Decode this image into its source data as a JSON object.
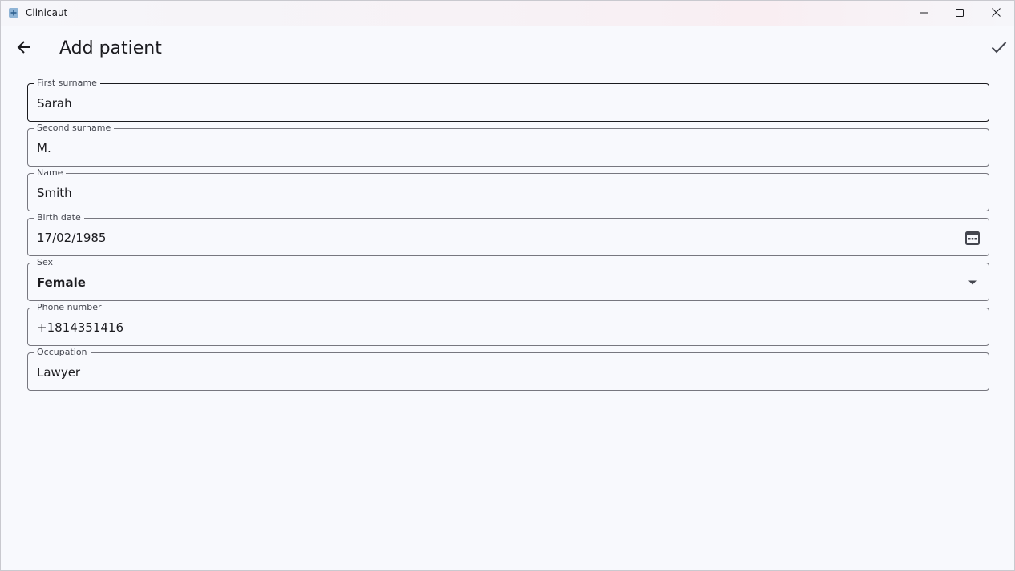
{
  "window": {
    "app_title": "Clinicaut",
    "app_icon": "app-plus-icon",
    "controls": {
      "minimize": "minimize-icon",
      "maximize": "maximize-icon",
      "close": "close-icon"
    }
  },
  "appbar": {
    "back_icon": "arrow-back-icon",
    "title": "Add patient",
    "save_icon": "check-icon"
  },
  "form": {
    "fields": [
      {
        "label": "First surname",
        "value": "Sarah"
      },
      {
        "label": "Second surname",
        "value": "M."
      },
      {
        "label": "Name",
        "value": "Smith"
      },
      {
        "label": "Birth date",
        "value": "17/02/1985",
        "trailing_icon": "calendar-icon"
      },
      {
        "label": "Sex",
        "value": "Female",
        "trailing_icon": "dropdown-arrow-icon"
      },
      {
        "label": "Phone number",
        "value": "+1814351416"
      },
      {
        "label": "Occupation",
        "value": "Lawyer"
      }
    ]
  },
  "colors": {
    "background": "#f8f9fd",
    "outline": "#77777f",
    "focused_outline": "#1b1b1f",
    "text": "#1b1b1f",
    "label": "#44464f"
  }
}
